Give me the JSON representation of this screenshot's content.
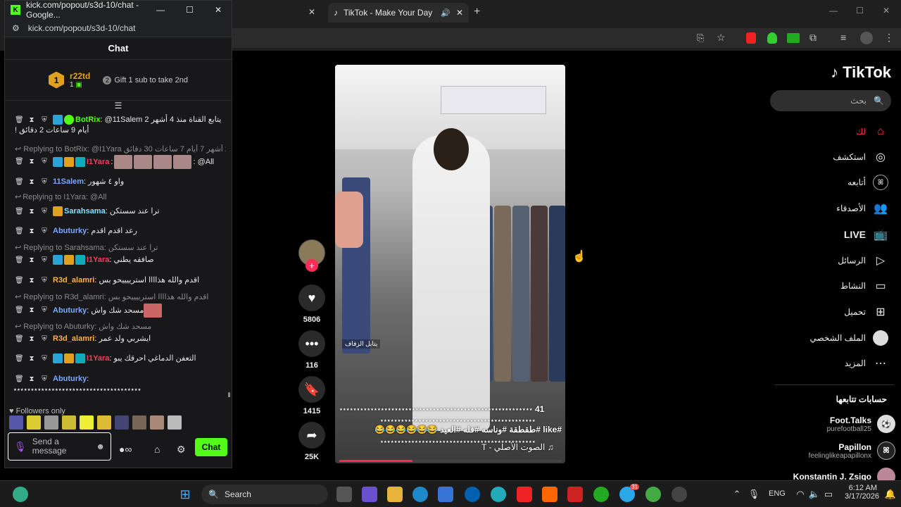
{
  "browser": {
    "tab_title": "TikTok - Make Your Day",
    "new_tab": "+"
  },
  "popup": {
    "window_title": "kick.com/popout/s3d-10/chat - Google...",
    "url": "kick.com/popout/s3d-10/chat",
    "chat_title": "Chat",
    "leader_rank": "1",
    "leader_name": "r22td",
    "leader_count": "1",
    "gift_text": "Gift 1 sub to take 2nd",
    "gift_rank": "2",
    "messages": [
      {
        "user": "BotRix",
        "text": ": @11Salem 2 يتابع القناة منذ 4 أشهر",
        "text2": "! أيام 9 ساعات 2 دقائق"
      },
      {
        "reply": "Replying to BotRix: @I1Yara يتابع القناة منذ 2 أشهر 7 أيام 7 ساعات 30 دقائق..."
      },
      {
        "user": "I1Yara",
        "text": ": @All"
      },
      {
        "user": "11Salem",
        "text": ": واو ٤ شهور"
      },
      {
        "reply": "Replying to I1Yara: @All"
      },
      {
        "user": "Sarahsama",
        "text": ": ترا عند سستكن"
      },
      {
        "user": "Abuturky",
        "text": ": رعد اقدم اقدم"
      },
      {
        "reply": "Replying to Sarahsama: ترا عند سستكن"
      },
      {
        "user": "I1Yara",
        "text": ": صافقه يطني"
      },
      {
        "user": "R3d_alamri",
        "text": ": اقدم والله هذاااا استرييييحو بس"
      },
      {
        "reply": "Replying to R3d_alamri: اقدم والله هذاااا استرييييحو بس"
      },
      {
        "user": "Abuturky",
        "text": ": مسحد شك واش"
      },
      {
        "reply": "Replying to Abuturky: مسحد شك واش"
      },
      {
        "user": "R3d_alamri",
        "text": ": ايشربي ولد عمر"
      },
      {
        "user": "I1Yara",
        "text": ": التعفن الدماغي احرقك يبو"
      },
      {
        "user": "Abuturky",
        "text": ":",
        "text2": "٭٭٭٭٭٭٭٭٭٭٭٭٭٭٭٭٭٭٭٭٭٭٭٭٭٭٭٭٭٭٭٭٭٭٭٭٭"
      }
    ],
    "followers_only": "Followers only",
    "send_placeholder": "Send a message",
    "chat_button": "Chat"
  },
  "video": {
    "username_tag": "41",
    "caption_line1": "٭٭٭٭٭٭٭٭٭٭٭٭٭٭٭٭٭٭٭٭٭٭٭٭٭٭٭٭٭٭٭٭٭٭٭٭٭٭٭٭٭٭٭٭٭٭٭٭٭٭٭٭٭٭٭٭٭٭٭٭٭٭٭٭٭٭٭",
    "caption_line2": "٭٭٭٭٭٭٭٭٭٭٭٭٭٭٭٭٭٭٭٭٭٭٭٭٭٭٭٭٭٭٭٭٭٭٭٭٭٭٭٭٭٭٭٭٭٭٭",
    "caption_tags": "#like #طقطقة #وناسه #فله #العيد 😂😂😂😂😂😂",
    "caption_line4": "٭٭٭٭٭٭٭٭٭٭٭٭٭٭٭٭٭٭٭٭٭٭٭٭٭٭٭٭٭٭٭٭٭٭٭٭٭٭٭٭٭٭٭٭٭٭٭",
    "sound": "T - الصوت الأصلي",
    "watermark": "يتابل الزفاف",
    "progress": 0.33
  },
  "actions": {
    "likes": "5806",
    "comments": "116",
    "saves": "1415",
    "shares": "25K"
  },
  "sidebar": {
    "logo": "TikTok",
    "search_placeholder": "بحث",
    "nav": [
      {
        "label": "لك",
        "icon": "home-icon"
      },
      {
        "label": "استكشف",
        "icon": "compass-icon"
      },
      {
        "label": "أتابعه",
        "icon": "following-icon"
      },
      {
        "label": "الأصدقاء",
        "icon": "friends-icon"
      },
      {
        "label": "LIVE",
        "icon": "live-icon"
      },
      {
        "label": "الرسائل",
        "icon": "send-icon"
      },
      {
        "label": "النشاط",
        "icon": "activity-icon"
      },
      {
        "label": "تحميل",
        "icon": "upload-icon"
      },
      {
        "label": "الملف الشخصي",
        "icon": "profile-icon"
      },
      {
        "label": "المزيد",
        "icon": "more-icon"
      }
    ],
    "following_title": "حسابات تتابعها",
    "accounts": [
      {
        "name": "Foot.Talks",
        "handle": "purefootball25"
      },
      {
        "name": "Papillon",
        "handle": "feelinglikeapapillonx"
      },
      {
        "name": "Konstantin J. Zsigo",
        "handle": ""
      }
    ]
  },
  "taskbar": {
    "search": "Search",
    "lang": "ENG",
    "time": "6:12 AM",
    "date": "3/17/2026",
    "badge_count": "31"
  },
  "colors": {
    "kick_green": "#53fc18",
    "tiktok_red": "#fe2c55"
  }
}
